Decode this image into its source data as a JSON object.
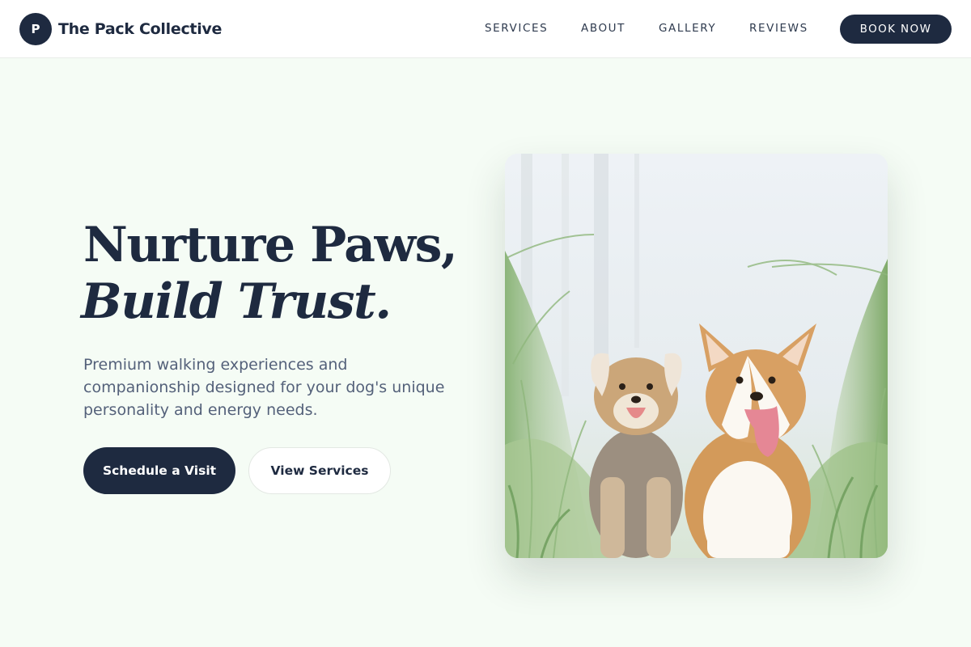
{
  "header": {
    "logo_letter": "P",
    "brand_name": "The Pack Collective",
    "nav": [
      {
        "label": "SERVICES"
      },
      {
        "label": "ABOUT"
      },
      {
        "label": "GALLERY"
      },
      {
        "label": "REVIEWS"
      }
    ],
    "cta_label": "BOOK NOW"
  },
  "hero": {
    "headline_line1": "Nurture Paws,",
    "headline_line2": "Build Trust.",
    "subtext": "Premium walking experiences and companionship designed for your dog's unique personality and energy needs.",
    "primary_button": "Schedule a Visit",
    "secondary_button": "View Services",
    "image_subject": "two happy dogs sitting in tall grass"
  },
  "colors": {
    "navy": "#1e2a40",
    "background": "#f5fcf5",
    "body_text": "#54617a",
    "white": "#ffffff"
  }
}
